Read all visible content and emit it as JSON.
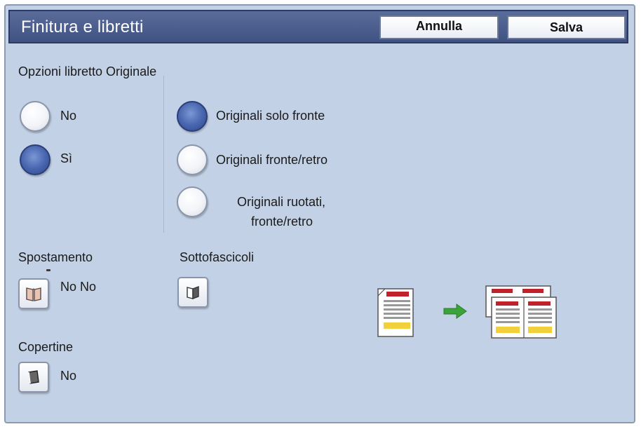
{
  "window": {
    "title": "Finitura e libretti",
    "cancel_label": "Annulla",
    "save_label": "Salva"
  },
  "booklet": {
    "heading": "Opzioni libretto Originale",
    "options": [
      {
        "label": "No",
        "selected": false
      },
      {
        "label": "Sì",
        "selected": true
      }
    ],
    "originals": [
      {
        "label": "Originali solo fronte",
        "selected": true
      },
      {
        "label": "Originali fronte/retro",
        "selected": false
      },
      {
        "label_line1": "Originali ruotati,",
        "label_line2": "fronte/retro",
        "selected": false
      }
    ]
  },
  "shift": {
    "label": "Spostamento",
    "value": "No No",
    "icon": "open-book-icon"
  },
  "subsets": {
    "label": "Sottofascicoli",
    "icon": "booklet-page-icon"
  },
  "covers": {
    "label": "Copertine",
    "value": "No",
    "icon": "cover-book-icon"
  },
  "illustration": {
    "source": "single-page-original-icon",
    "arrow": "green-arrow-icon",
    "result": "booklet-spread-icon"
  },
  "colors": {
    "accent": "#3f5282",
    "panel": "#c3d1e6",
    "selected": "#4a67b1",
    "arrow": "#3aa33a",
    "doc_red": "#c0212a",
    "doc_yellow": "#f2d03b"
  }
}
